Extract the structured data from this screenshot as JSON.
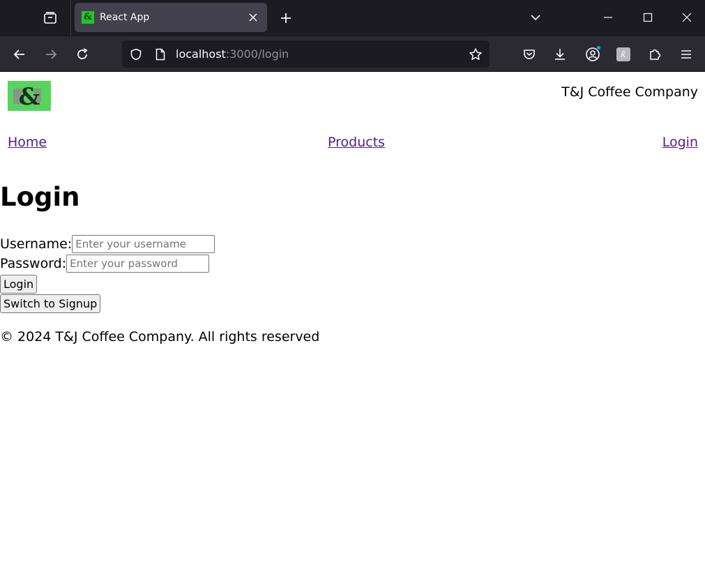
{
  "browser": {
    "tab": {
      "title": "React App",
      "favicon_glyph": "&"
    },
    "url": {
      "host": "localhost",
      "path": ":3000/login"
    },
    "icons": {
      "tab_overview": "tab-overview-icon",
      "close_tab": "close-icon",
      "new_tab": "plus-icon",
      "tab_list": "chevron-down-icon",
      "minimize": "minimize-icon",
      "maximize": "maximize-icon",
      "close_window": "close-icon",
      "back": "arrow-left-icon",
      "forward": "arrow-right-icon",
      "reload": "reload-icon",
      "tracking": "shield-icon",
      "page_info": "page-icon",
      "bookmark": "star-icon",
      "pocket": "pocket-icon",
      "downloads": "download-icon",
      "account": "account-icon",
      "extension": "extension-badge-icon",
      "extensions": "puzzle-icon",
      "menu": "hamburger-menu-icon"
    },
    "extension_badge": "ƙ",
    "colors": {
      "tabbar": "#1c1b22",
      "toolbar": "#2b2a33",
      "active_tab": "#42414d",
      "favicon": "#25c425",
      "notification_dot": "#00b3f4"
    }
  },
  "page": {
    "header": {
      "company_name": "T&J Coffee Company",
      "logo_color": "#56d55e"
    },
    "nav": {
      "home": "Home",
      "products": "Products",
      "login": "Login",
      "link_color": "#551a8b"
    },
    "title": "Login",
    "form": {
      "username_label": "Username:",
      "username_placeholder": "Enter your username",
      "username_value": "",
      "password_label": "Password:",
      "password_placeholder": "Enter your password",
      "password_value": "",
      "login_button": "Login",
      "switch_button": "Switch to Signup"
    },
    "footer": "© 2024 T&J Coffee Company. All rights reserved"
  }
}
